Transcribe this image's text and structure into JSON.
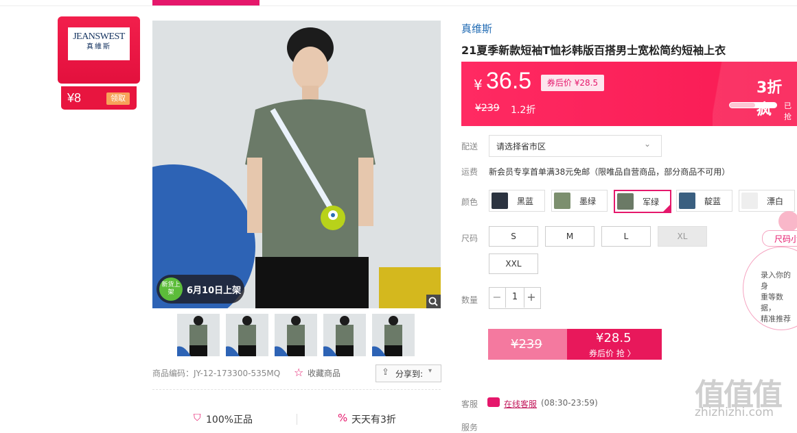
{
  "brand_card": {
    "logo_line1": "JEANSWEST",
    "logo_line2": "真維斯",
    "coupon_value": "¥8",
    "coupon_button": "领取"
  },
  "gallery": {
    "new_badge_icon_text": "新货上架",
    "new_badge_text": "6月10日上架",
    "thumbnails": [
      "thumb-1",
      "thumb-2",
      "thumb-3",
      "thumb-4",
      "thumb-5"
    ]
  },
  "meta": {
    "sku": "商品编码：JY-12-173300-535MQ",
    "favorite": "收藏商品",
    "share": "分享到:"
  },
  "guarantees": [
    "100%正品",
    "天天有3折"
  ],
  "product": {
    "brand": "真维斯",
    "title": "21夏季新款短袖T恤衫韩版百搭男士宽松简约短袖上衣"
  },
  "price": {
    "currency": "¥",
    "current": "36.5",
    "after_coupon_tag": "券后价 ¥28.5",
    "original": "¥239",
    "discount": "1.2折",
    "flash_text": "3折疯",
    "sold_label": "已抢",
    "sold_fraction": 0.55
  },
  "labels": {
    "delivery": "配送",
    "freight": "运费",
    "color": "颜色",
    "size": "尺码",
    "quantity": "数量",
    "service": "客服",
    "promo": "服务"
  },
  "delivery": {
    "placeholder": "请选择省市区"
  },
  "freight_text": "新会员专享首单满38元免邮（限唯品自营商品，部分商品不可用）",
  "colors": [
    {
      "name": "黑蓝",
      "swatch": "#2b3340",
      "selected": false
    },
    {
      "name": "墨绿",
      "swatch": "#7c8f6e",
      "selected": false
    },
    {
      "name": "军绿",
      "swatch": "#6b7a66",
      "selected": true
    },
    {
      "name": "靛蓝",
      "swatch": "#3a5f80",
      "selected": false
    },
    {
      "name": "漂白",
      "swatch": "#eeeeee",
      "selected": false
    }
  ],
  "sizes": [
    {
      "label": "S",
      "available": true
    },
    {
      "label": "M",
      "available": true
    },
    {
      "label": "L",
      "available": true
    },
    {
      "label": "XL",
      "available": false
    },
    {
      "label": "XXL",
      "available": true
    }
  ],
  "quantity": {
    "minus": "−",
    "value": "1",
    "plus": "+"
  },
  "buy": {
    "original": "¥239",
    "price": "¥28.5",
    "sub": "券后价 抢 〉"
  },
  "service": {
    "link": "在线客服",
    "hours": "(08:30-23:59)"
  },
  "size_helper": {
    "pill": "尺码小",
    "lines": [
      "录入你的身",
      "重等数据，",
      "精准推荐"
    ]
  },
  "watermark": {
    "logo": "值值值",
    "url": "zhizhizhi.com"
  },
  "colors_theme": {
    "accent": "#e5176b",
    "price_bg": "#ff2a62",
    "link": "#1f6ab3"
  }
}
